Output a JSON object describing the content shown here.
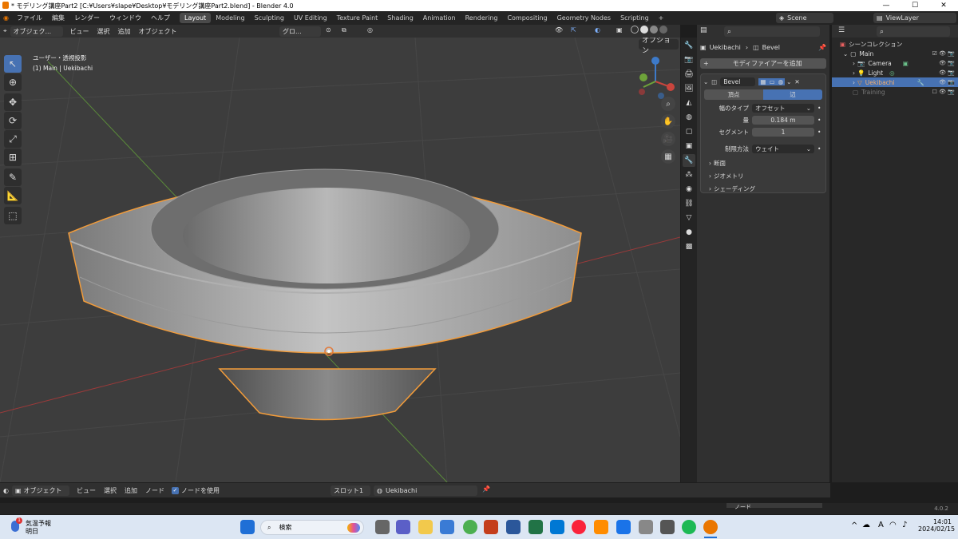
{
  "window": {
    "title": "* モデリング講座Part2 [C:¥Users¥slape¥Desktop¥モデリング講座Part2.blend] - Blender 4.0"
  },
  "menu": [
    "ファイル",
    "編集",
    "レンダー",
    "ウィンドウ",
    "ヘルプ"
  ],
  "workspaces": [
    "Layout",
    "Modeling",
    "Sculpting",
    "UV Editing",
    "Texture Paint",
    "Shading",
    "Animation",
    "Rendering",
    "Compositing",
    "Geometry Nodes",
    "Scripting"
  ],
  "workspace_add": "+",
  "scene": "Scene",
  "viewlayer": "ViewLayer",
  "viewport": {
    "mode": "オブジェク...",
    "menus": [
      "ビュー",
      "選択",
      "追加",
      "オブジェクト"
    ],
    "transform_orientation": "グロ...",
    "options": "オプション",
    "overlay_line1": "ユーザー・透視投影",
    "overlay_line2": "(1) Main | Uekibachi"
  },
  "properties": {
    "breadcrumb_object": "Uekibachi",
    "breadcrumb_sep": "›",
    "breadcrumb_modifier": "Bevel",
    "add_modifier": "モディファイアーを追加",
    "modifier_name": "Bevel",
    "tab_vertex": "頂点",
    "tab_edge": "辺",
    "width_type_label": "幅のタイプ",
    "width_type_value": "オフセット",
    "amount_label": "量",
    "amount_value": "0.184 m",
    "segments_label": "セグメント",
    "segments_value": "1",
    "limit_label": "制限方法",
    "limit_value": "ウェイト",
    "sections": [
      "断面",
      "ジオメトリ",
      "シェーディング"
    ]
  },
  "outliner": {
    "root": "シーンコレクション",
    "items": [
      {
        "name": "Main",
        "selected": false,
        "dim": false
      },
      {
        "name": "Camera",
        "selected": false,
        "dim": false
      },
      {
        "name": "Light",
        "selected": false,
        "dim": false
      },
      {
        "name": "Uekibachi",
        "selected": true,
        "dim": false
      },
      {
        "name": "Training",
        "selected": false,
        "dim": true
      }
    ]
  },
  "bottom": {
    "mode": "オブジェクト",
    "menus": [
      "ビュー",
      "選択",
      "追加",
      "ノード"
    ],
    "use_nodes": "ノードを使用",
    "slot": "スロット1",
    "material": "Uekibachi"
  },
  "status": {
    "panel_label": "ノード",
    "version": "4.0.2"
  },
  "taskbar": {
    "weather_title": "気温予報",
    "weather_sub": "明日",
    "weather_badge": "1",
    "search": "検索",
    "time": "14:01",
    "date": "2024/02/15",
    "ime": "A"
  },
  "colors": {
    "accent": "#4772b3",
    "selection": "#f39c3a",
    "x_axis": "#c9453d",
    "y_axis": "#6ea33a",
    "z_axis": "#3d7ac9"
  }
}
